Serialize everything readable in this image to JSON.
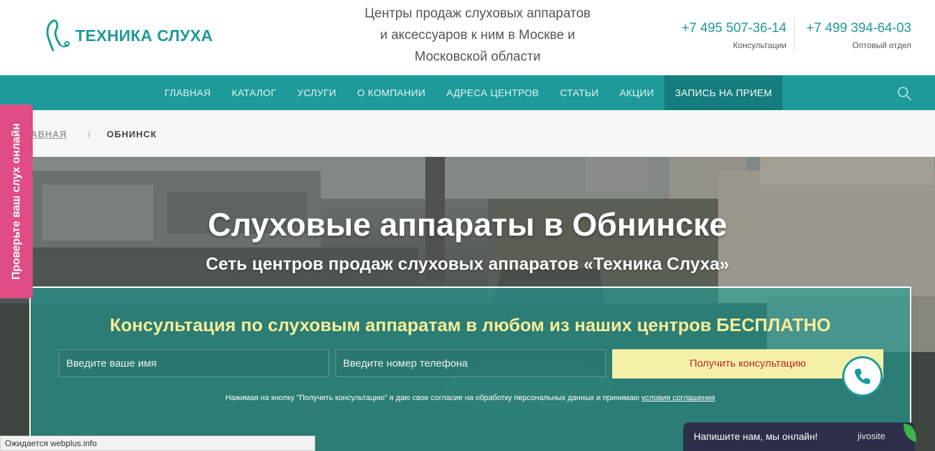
{
  "header": {
    "logo_text": "ТЕХНИКА СЛУХА",
    "tagline": [
      "Центры продаж слуховых аппаратов",
      "и аксессуаров к ним в Москве и",
      "Московской области"
    ],
    "phones": [
      {
        "number": "+7 495 507-36-14",
        "caption": "Консультации"
      },
      {
        "number": "+7 499 394-64-03",
        "caption": "Оптовый отдел"
      }
    ]
  },
  "nav": {
    "items": [
      "ГЛАВНАЯ",
      "КАТАЛОГ",
      "УСЛУГИ",
      "О КОМПАНИИ",
      "АДРЕСА ЦЕНТРОВ",
      "СТАТЬИ",
      "АКЦИИ",
      "ЗАПИСЬ НА ПРИЕМ"
    ],
    "active_index": 7
  },
  "breadcrumb": {
    "home": "ЛАВНАЯ",
    "separator": "/",
    "current": "ОБНИНСК"
  },
  "hero": {
    "title": "Слуховые аппараты в Обнинске",
    "subtitle": "Сеть центров продаж слуховых аппаратов «Техника Слуха»"
  },
  "form": {
    "title": "Консультация по слуховым аппаратам в любом из наших центров БЕСПЛАТНО",
    "name_placeholder": "Введите ваше имя",
    "phone_placeholder": "Введите номер телефона",
    "submit_label": "Получить консультацию",
    "consent_text": "Нажимая на кнопку \"Получить консультацию\" я даю свое согласие на обработку персональных данных и принимаю",
    "consent_link": "условия соглашения"
  },
  "side_tab": {
    "label": "Проверьте ваш слух онлайн"
  },
  "status_bar": {
    "text": "Ожидается webplus.info"
  },
  "chat": {
    "message": "Напишите нам, мы онлайн!",
    "brand": "jivosite"
  },
  "colors": {
    "brand": "#1e9a9a",
    "accent_pink": "#e04d86",
    "button_bg": "#f5f0a8",
    "button_text": "#c0282d"
  }
}
